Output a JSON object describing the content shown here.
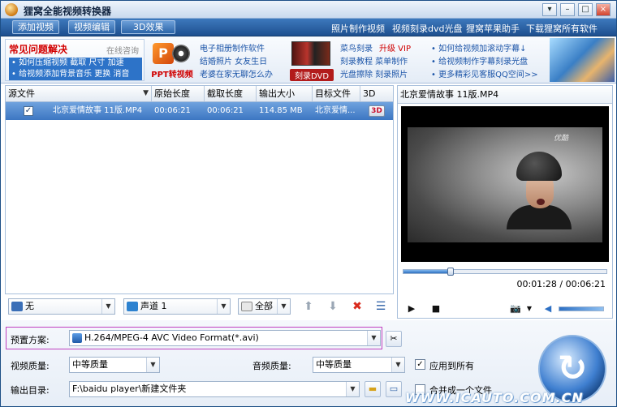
{
  "window": {
    "title": "狸窝全能视频转换器",
    "controls": {
      "menu": "▾",
      "minimize": "–",
      "maximize": "□",
      "close": "×"
    }
  },
  "menubar": {
    "buttons": [
      "添加视频",
      "视频编辑",
      "3D效果"
    ],
    "links": [
      "照片制作视频",
      "视频刻录dvd光盘",
      "狸窝苹果助手",
      "下载狸窝所有软件"
    ]
  },
  "banner": {
    "faq_title": "常见问题解决",
    "faq_online": "在线咨询",
    "faq_lines": [
      "• 如何压缩视频 截取 尺寸 加速",
      "• 给视频添加背景音乐 更换 消音"
    ],
    "ppt_letter": "P",
    "ppt_label": "PPT转视频",
    "ppt_links": [
      "电子相册制作软件",
      "结婚照片 女友生日",
      "老婆在家无聊怎么办"
    ],
    "dvd_label": "刻录DVD",
    "dvd_links_red": [
      "菜鸟刻录",
      "升级 VIP"
    ],
    "dvd_links": [
      "刻录教程 菜单制作",
      "光盘擦除 刻录照片"
    ],
    "right_links": [
      "• 如何给视频加滚动字幕↓",
      "• 给视频制作字幕刻录光盘",
      "• 更多精彩见客服QQ空间>>"
    ]
  },
  "file_table": {
    "columns": [
      "源文件",
      "原始长度",
      "截取长度",
      "输出大小",
      "目标文件",
      "3D"
    ],
    "rows": [
      {
        "checked": "✓",
        "source": "北京爱情故事 11版.MP4",
        "original_length": "00:06:21",
        "clip_length": "00:06:21",
        "output_size": "114.85 MB",
        "target": "北京爱情...",
        "badge3d": "3D"
      }
    ]
  },
  "subtitle_bar": {
    "subtitle": "无",
    "audio_track": "声道 1",
    "select_all": "全部"
  },
  "preview": {
    "title": "北京爱情故事 11版.MP4",
    "watermark": "优酷",
    "time": "00:01:28 / 00:06:21",
    "progress": 0.23
  },
  "settings": {
    "preset_label": "预置方案:",
    "preset_value": "H.264/MPEG-4 AVC Video Format(*.avi)",
    "video_quality_label": "视频质量:",
    "video_quality": "中等质量",
    "audio_quality_label": "音频质量:",
    "audio_quality": "中等质量",
    "apply_all_label": "应用到所有",
    "apply_all_checked": "✓",
    "output_dir_label": "输出目录:",
    "output_dir": "F:\\baidu player\\新建文件夹",
    "merge_label": "合并成一个文件"
  },
  "site_watermark": "WWW.ICAUTO.COM.CN"
}
